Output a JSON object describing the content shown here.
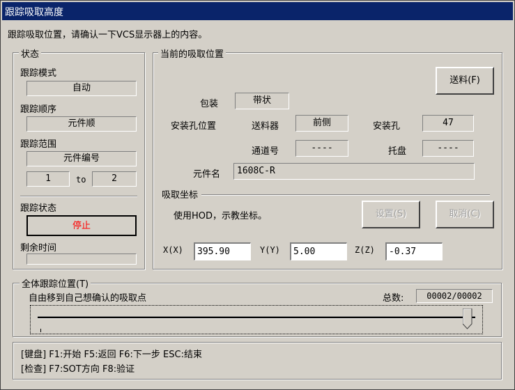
{
  "window": {
    "title": "跟踪吸取高度"
  },
  "instruction": "跟踪吸取位置，请确认一下VCS显示器上的内容。",
  "status": {
    "legend": "状态",
    "mode_label": "跟踪模式",
    "mode_value": "自动",
    "order_label": "跟踪顺序",
    "order_value": "元件顺",
    "range_label": "跟踪范围",
    "range_value": "元件编号",
    "range_from": "1",
    "range_to_label": "to",
    "range_to": "2",
    "track_state_label": "跟踪状态",
    "track_state_value": "停止",
    "remaining_label": "剩余时间",
    "remaining_value": ""
  },
  "current": {
    "legend": "当前的吸取位置",
    "feed_button": "送料(F)",
    "package_label": "包装",
    "package_value": "带状",
    "mount_hole_pos_label": "安装孔位置",
    "feeder_label": "送料器",
    "feeder_value": "前侧",
    "mount_hole_label": "安装孔",
    "mount_hole_value": "47",
    "channel_label": "通道号",
    "channel_value": "----",
    "tray_label": "托盘",
    "tray_value": "----",
    "part_name_label": "元件名",
    "part_name_value": "1608C-R"
  },
  "pick_coord": {
    "legend": "吸取坐标",
    "hint": "使用HOD，示教坐标。",
    "set_button": "设置(S)",
    "cancel_button": "取消(C)",
    "x_label": "X(X)",
    "x_value": "395.90",
    "y_label": "Y(Y)",
    "y_value": "5.00",
    "z_label": "Z(Z)",
    "z_value": "-0.37"
  },
  "overall": {
    "legend": "全体跟踪位置(T)",
    "hint": "自由移到自己想确认的吸取点",
    "total_label": "总数:",
    "total_value": "00002/00002"
  },
  "keys": {
    "line1": "[键盘]  F1:开始  F5:返回  F6:下一步  ESC:结束",
    "line2": "[检查]  F7:SOT方向  F8:验证"
  },
  "colors": {
    "title_bar": "#0a246a",
    "stop_text": "#ff0000",
    "face": "#d4d0c8"
  }
}
